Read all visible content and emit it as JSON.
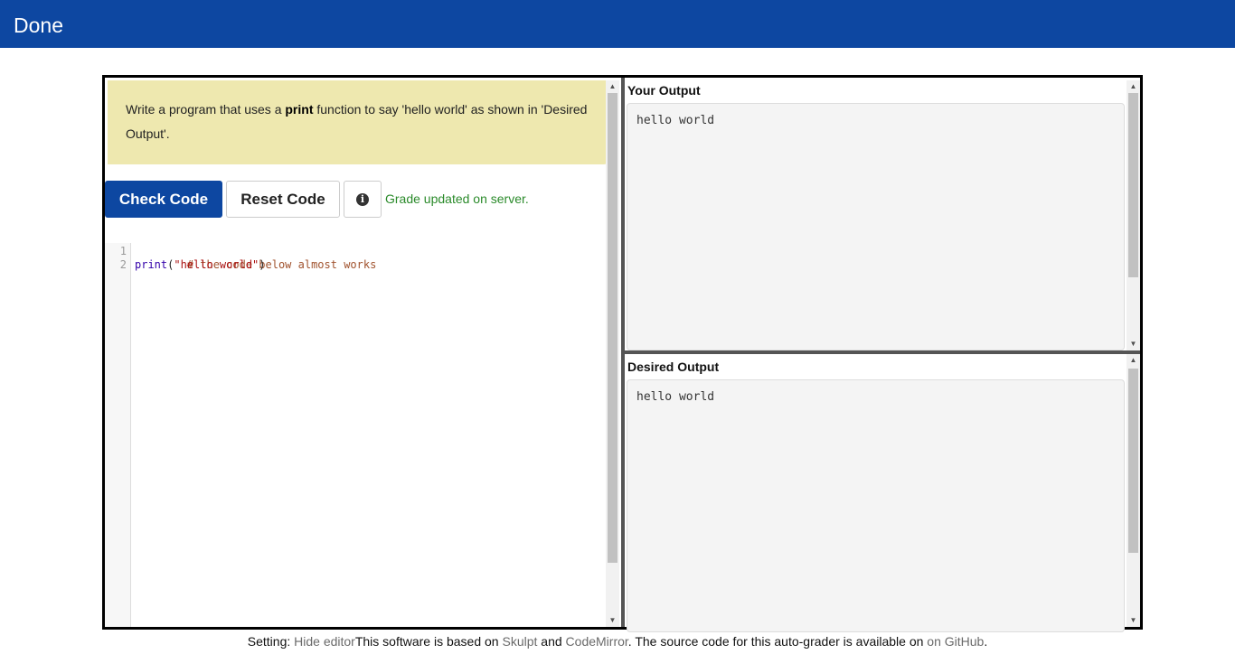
{
  "header": {
    "title": "Done"
  },
  "problem": {
    "instructions_before": "Write a program that uses a ",
    "instructions_keyword": "print",
    "instructions_after": " function to say 'hello world' as shown in 'Desired Output'."
  },
  "toolbar": {
    "check_label": "Check Code",
    "reset_label": "Reset Code",
    "info_glyph": "i",
    "status_text": "Grade updated on server.",
    "status_color": "#2a8a2a",
    "accent_color": "#0d47a1"
  },
  "editor": {
    "line_numbers": [
      "1",
      "2"
    ],
    "line1_comment": "# the code below almost works",
    "line2_builtin": "print",
    "line2_open": "(",
    "line2_string": "\"hello world\"",
    "line2_close": ")"
  },
  "your_output": {
    "label": "Your Output",
    "text": "hello world"
  },
  "desired_output": {
    "label": "Desired Output",
    "text": "hello world"
  },
  "footer": {
    "setting_prefix": "Setting: ",
    "hide_editor_link": "Hide editor",
    "based_on_text": "This software is based on ",
    "skulpt_link": "Skulpt",
    "and_text": " and ",
    "codemirror_link": "CodeMirror",
    "source_text": ". The source code for this auto-grader is available on ",
    "github_link": "on GitHub",
    "end_text": "."
  }
}
